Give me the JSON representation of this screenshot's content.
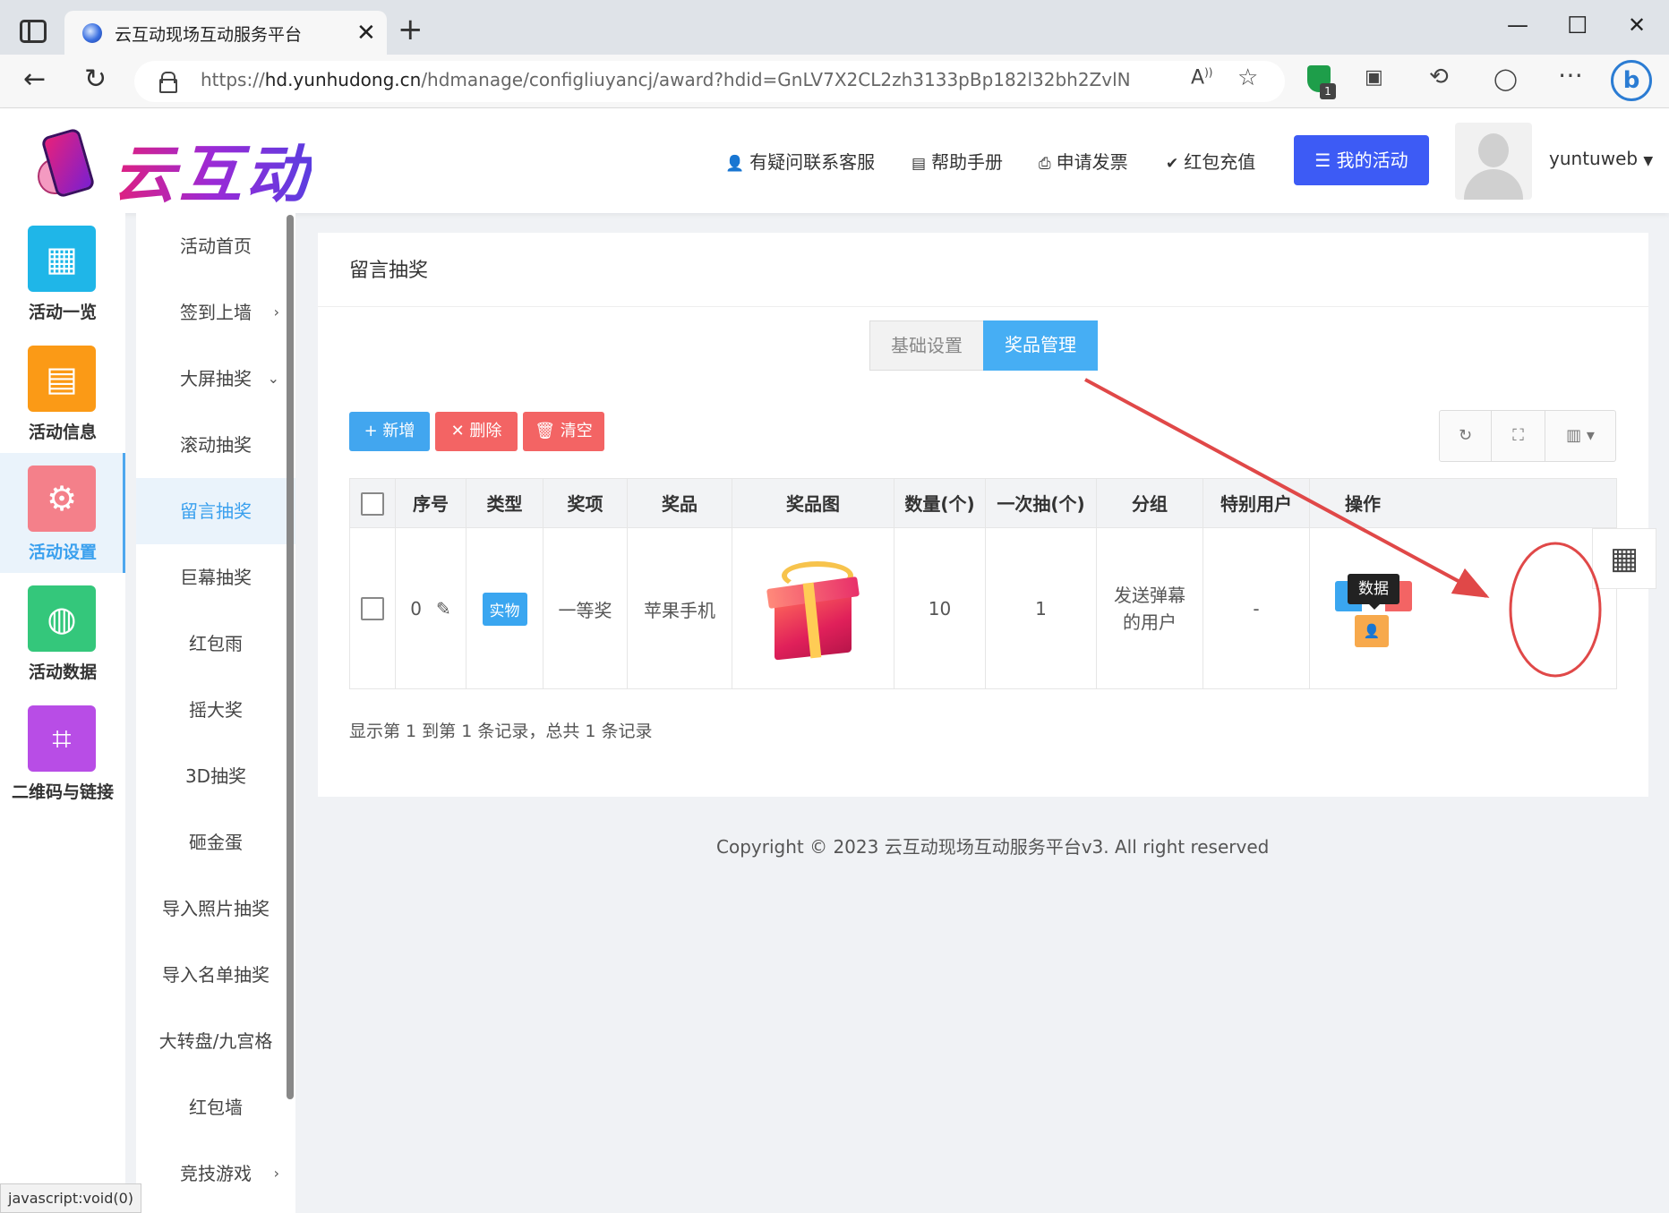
{
  "browser": {
    "tab_title": "云互动现场互动服务平台",
    "url_prefix": "https://",
    "url_host": "hd.yunhudong.cn",
    "url_path": "/hdmanage/configliuyancj/award?hdid=GnLV7X2CL2zh3133pBp182l32bh2ZvlN",
    "ext_badge": "1",
    "status_text": "javascript:void(0)"
  },
  "header": {
    "logo": "云互动",
    "links": [
      {
        "icon": "user-plus-icon",
        "label": "有疑问联系客服"
      },
      {
        "icon": "book-icon",
        "label": "帮助手册"
      },
      {
        "icon": "printer-icon",
        "label": "申请发票"
      },
      {
        "icon": "shield-check-icon",
        "label": "红包充值"
      }
    ],
    "my_activity": "我的活动",
    "username": "yuntuweb"
  },
  "icon_sidebar": [
    {
      "label": "活动一览",
      "icon": "grid-icon",
      "color": "#1fb6e8"
    },
    {
      "label": "活动信息",
      "icon": "document-icon",
      "color": "#fb9a16"
    },
    {
      "label": "活动设置",
      "icon": "gear-icon",
      "color": "#f4808a"
    },
    {
      "label": "活动数据",
      "icon": "database-icon",
      "color": "#34c77b"
    },
    {
      "label": "二维码与链接",
      "icon": "qrcode-icon",
      "color": "#b84de6"
    }
  ],
  "submenu": [
    {
      "label": "活动首页"
    },
    {
      "label": "签到上墙",
      "arrow": "›"
    },
    {
      "label": "大屏抽奖",
      "arrow": "⌄"
    },
    {
      "label": "滚动抽奖"
    },
    {
      "label": "留言抽奖"
    },
    {
      "label": "巨幕抽奖"
    },
    {
      "label": "红包雨"
    },
    {
      "label": "摇大奖"
    },
    {
      "label": "3D抽奖"
    },
    {
      "label": "砸金蛋"
    },
    {
      "label": "导入照片抽奖"
    },
    {
      "label": "导入名单抽奖"
    },
    {
      "label": "大转盘/九宫格"
    },
    {
      "label": "红包墙"
    },
    {
      "label": "竞技游戏",
      "arrow": "›"
    }
  ],
  "panel": {
    "title": "留言抽奖",
    "tab_basic": "基础设置",
    "tab_prize": "奖品管理",
    "btn_add": "+ 新增",
    "btn_delete": "✕ 删除",
    "btn_clear": "清空",
    "columns": [
      "序号",
      "类型",
      "奖项",
      "奖品",
      "奖品图",
      "数量(个)",
      "一次抽(个)",
      "分组",
      "特别用户",
      "操作"
    ],
    "row": {
      "index": "0",
      "type": "实物",
      "level": "一等奖",
      "prize": "苹果手机",
      "quantity": "10",
      "per_draw": "1",
      "group": "发送弹幕的用户",
      "special": "-",
      "tooltip": "数据"
    },
    "summary": "显示第 1 到第 1 条记录，总共 1 条记录"
  },
  "copyright": "Copyright © 2023 云互动现场互动服务平台v3. All right reserved",
  "colors": {
    "accent": "#46aef4",
    "danger": "#f36464",
    "primary": "#3d5bf5",
    "annotation": "#e04848"
  }
}
